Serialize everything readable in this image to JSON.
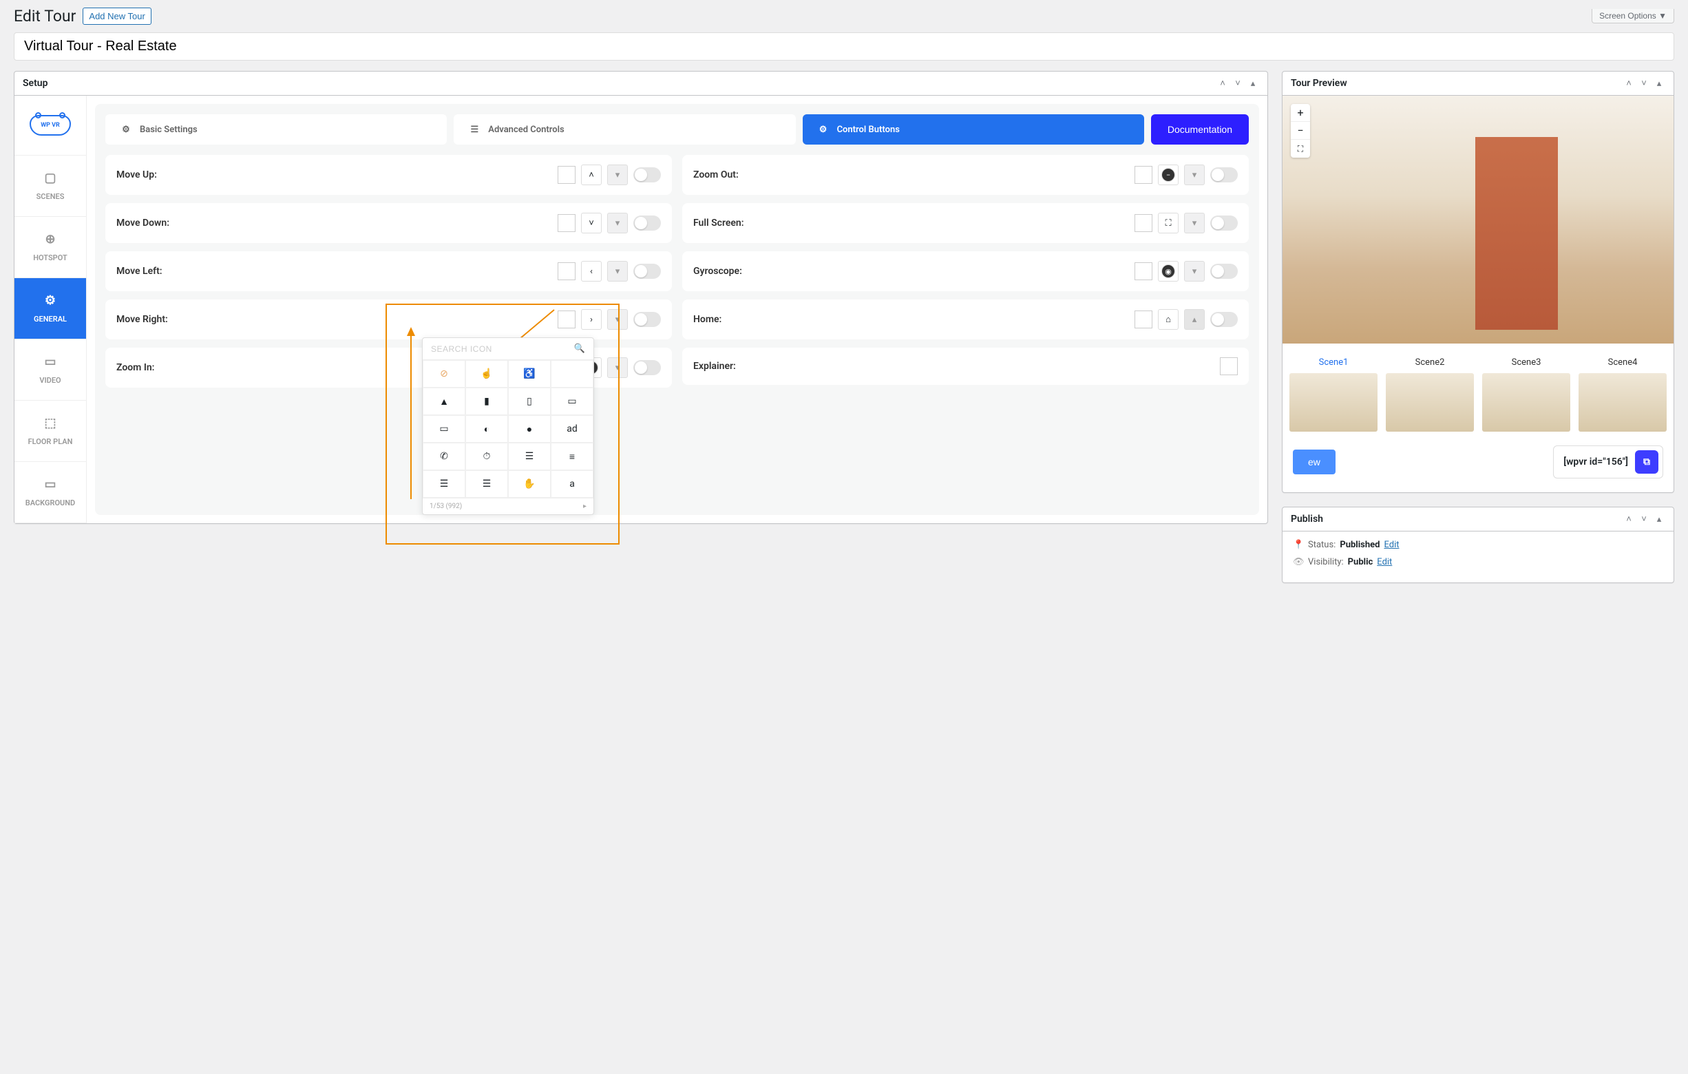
{
  "header": {
    "title": "Edit Tour",
    "add_new": "Add New Tour",
    "screen_options": "Screen Options"
  },
  "tour_title": "Virtual Tour - Real Estate",
  "setup": {
    "panel_title": "Setup",
    "logo_text": "WP VR",
    "sidebar": [
      {
        "label": "SCENES",
        "icon": "image"
      },
      {
        "label": "HOTSPOT",
        "icon": "target"
      },
      {
        "label": "GENERAL",
        "icon": "gear"
      },
      {
        "label": "VIDEO",
        "icon": "video"
      },
      {
        "label": "FLOOR PLAN",
        "icon": "map"
      },
      {
        "label": "BACKGROUND",
        "icon": "layers"
      }
    ],
    "top_tabs": {
      "basic": "Basic Settings",
      "advanced": "Advanced Controls",
      "control": "Control Buttons"
    },
    "documentation": "Documentation",
    "controls_left": [
      {
        "label": "Move Up:",
        "icon": "up"
      },
      {
        "label": "Move Down:",
        "icon": "down"
      },
      {
        "label": "Move Left:",
        "icon": "left"
      },
      {
        "label": "Move Right:",
        "icon": "right"
      },
      {
        "label": "Zoom In:",
        "icon": "plus"
      }
    ],
    "controls_right": [
      {
        "label": "Zoom Out:",
        "icon": "minus"
      },
      {
        "label": "Full Screen:",
        "icon": "fullscreen"
      },
      {
        "label": "Gyroscope:",
        "icon": "gyro"
      },
      {
        "label": "Home:",
        "icon": "home"
      },
      {
        "label": "Explainer:",
        "icon": "none"
      }
    ]
  },
  "icon_picker": {
    "placeholder": "Search Icon",
    "footer": "1/53 (992)"
  },
  "preview": {
    "panel_title": "Tour Preview",
    "scenes": [
      "Scene1",
      "Scene2",
      "Scene3",
      "Scene4"
    ],
    "preview_btn": "ew",
    "shortcode": "[wpvr id=\"156\"]"
  },
  "publish": {
    "panel_title": "Publish",
    "status_label": "Status:",
    "status_value": "Published",
    "visibility_label": "Visibility:",
    "visibility_value": "Public",
    "edit": "Edit"
  }
}
